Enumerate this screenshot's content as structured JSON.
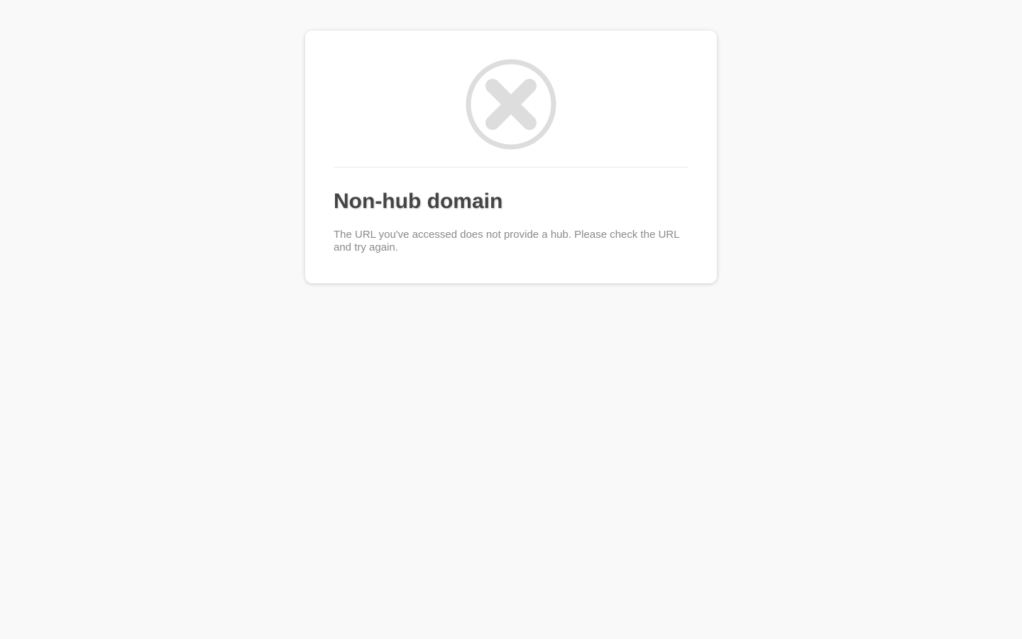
{
  "error": {
    "icon": "circle-x-icon",
    "icon_color": "#dddddd",
    "title": "Non-hub domain",
    "message": "The URL you've accessed does not provide a hub. Please check the URL and try again."
  },
  "colors": {
    "background": "#f9f9f9",
    "card": "#ffffff",
    "title": "#444444",
    "message": "#8a8a8a"
  }
}
